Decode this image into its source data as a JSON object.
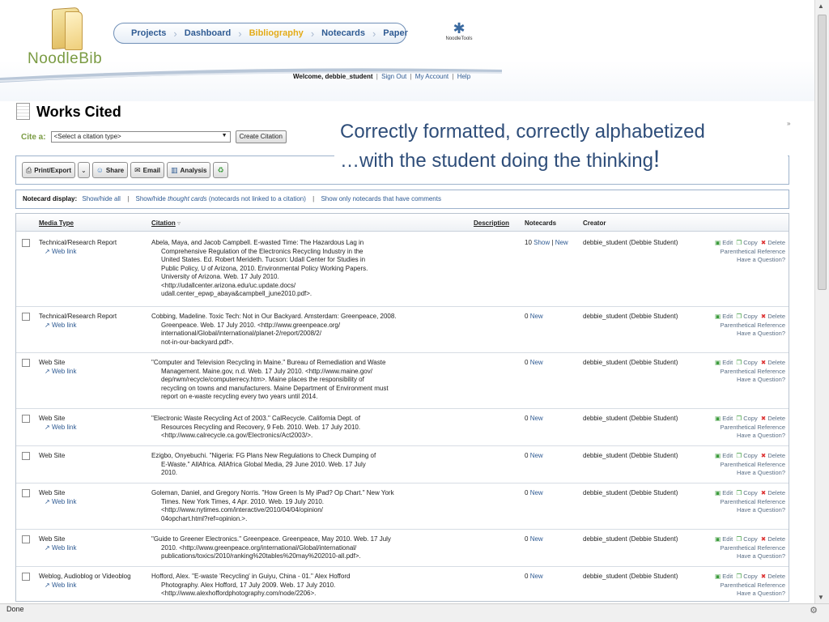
{
  "header": {
    "logo_text": "NoodleBib",
    "nav": [
      "Projects",
      "Dashboard",
      "Bibliography",
      "Notecards",
      "Paper"
    ],
    "nav_active": "Bibliography",
    "noodletools_label": "NoodleTools",
    "welcome_prefix": "Welcome,",
    "username": "debbie_student",
    "links": [
      "Sign Out",
      "My Account",
      "Help"
    ]
  },
  "page": {
    "title": "Works Cited",
    "cite_label": "Cite a:",
    "cite_select": "<Select a citation type>",
    "create_button": "Create Citation"
  },
  "toolbar": {
    "print_export": "Print/Export",
    "share": "Share",
    "email": "Email",
    "analysis": "Analysis"
  },
  "overlay": {
    "line1": "Correctly formatted, correctly alphabetized",
    "line2_a": "…with the student doing the thinking",
    "line2_b": "!"
  },
  "notecard_bar": {
    "label": "Notecard display:",
    "show_hide_all": "Show/hide all",
    "thought_prefix": "Show/hide",
    "thought_italic": "thought cards",
    "thought_suffix": "(notecards not linked to a citation)",
    "only_comments": "Show only notecards that have comments"
  },
  "table": {
    "headers": {
      "media_type": "Media Type",
      "citation": "Citation",
      "description": "Description",
      "notecards": "Notecards",
      "creator": "Creator"
    },
    "actions": {
      "edit": "Edit",
      "copy": "Copy",
      "delete": "Delete",
      "paren": "Parenthetical Reference",
      "question": "Have a Question?"
    },
    "web_link": "Web link",
    "rows": [
      {
        "media": "Technical/Research Report",
        "lines": [
          "Abela, Maya, and Jacob Campbell. E-wasted Time: The Hazardous Lag in",
          "Comprehensive Regulation of the Electronics Recycling Industry in the",
          "United States. Ed. Robert Merideth. Tucson: Udall Center for Studies in",
          "Public Policy, U of Arizona, 2010. Environmental Policy Working Papers.",
          "University of Arizona. Web. 17 July 2010.",
          "<http://udallcenter.arizona.edu/uc.update.docs/",
          "udall.center_epwp_abaya&campbell_june2010.pdf>."
        ],
        "count": "10",
        "show": "Show",
        "new": "New",
        "creator": "debbie_student (Debbie Student)"
      },
      {
        "media": "Technical/Research Report",
        "lines": [
          "Cobbing, Madeline. Toxic Tech: Not in Our Backyard. Amsterdam: Greenpeace, 2008.",
          "Greenpeace. Web. 17 July 2010. <http://www.greenpeace.org/",
          "international/Global/international/planet-2/report/2008/2/",
          "not-in-our-backyard.pdf>."
        ],
        "count": "0",
        "new": "New",
        "creator": "debbie_student (Debbie Student)"
      },
      {
        "media": "Web Site",
        "lines": [
          "\"Computer and Television Recycling in Maine.\" Bureau of Remediation and Waste",
          "Management. Maine.gov, n.d. Web. 17 July 2010. <http://www.maine.gov/",
          "dep/rwm/recycle/computerrecy.htm>. Maine places the responsibility of",
          "recycling on towns and manufacturers. Maine Department of Environment must",
          "report on e-waste recycling every two years until 2014."
        ],
        "count": "0",
        "new": "New",
        "creator": "debbie_student (Debbie Student)"
      },
      {
        "media": "Web Site",
        "lines": [
          "\"Electronic Waste Recycling Act of 2003.\" CalRecycle. California Dept. of",
          "Resources Recycling and Recovery, 9 Feb. 2010. Web. 17 July 2010.",
          "<http://www.calrecycle.ca.gov/Electronics/Act2003/>."
        ],
        "count": "0",
        "new": "New",
        "creator": "debbie_student (Debbie Student)"
      },
      {
        "media": "Web Site",
        "lines": [
          "Ezigbo, Onyebuchi. \"Nigeria: FG Plans New Regulations to Check Dumping of",
          "E-Waste.\" AllAfrica. AllAfrica Global Media, 29 June 2010. Web. 17 July",
          "2010."
        ],
        "count": "0",
        "new": "New",
        "creator": "debbie_student (Debbie Student)"
      },
      {
        "media": "Web Site",
        "lines": [
          "Goleman, Daniel, and Gregory Norris. \"How Green Is My iPad? Op Chart.\" New York",
          "Times. New York Times, 4 Apr. 2010. Web. 19 July 2010.",
          "<http://www.nytimes.com/interactive/2010/04/04/opinion/",
          "04opchart.html?ref=opinion.>."
        ],
        "count": "0",
        "new": "New",
        "creator": "debbie_student (Debbie Student)"
      },
      {
        "media": "Web Site",
        "lines": [
          "\"Guide to Greener Electronics.\" Greenpeace. Greenpeace, May 2010. Web. 17 July",
          "2010. <http://www.greenpeace.org/international/Global/international/",
          "publications/toxics/2010/ranking%20tables%20may%202010-all.pdf>."
        ],
        "count": "0",
        "new": "New",
        "creator": "debbie_student (Debbie Student)"
      },
      {
        "media": "Weblog, Audioblog or Videoblog",
        "lines": [
          "Hofford, Alex. \"E-waste 'Recycling' in Guiyu, China - 01.\" Alex Hofford",
          "Photography. Alex Hofford, 17 July 2009. Web. 17 July 2010.",
          "<http://www.alexhoffordphotography.com/node/2206>."
        ],
        "count": "0",
        "new": "New",
        "creator": "debbie_student (Debbie Student)"
      }
    ]
  },
  "status": {
    "text": "Done"
  },
  "colors": {
    "brand_green": "#7a9b43",
    "link_blue": "#2f5b93",
    "nav_active": "#e3ab19",
    "overlay_text": "#2e4d79"
  }
}
